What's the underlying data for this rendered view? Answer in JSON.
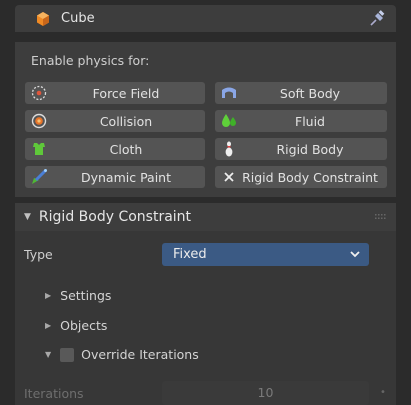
{
  "header": {
    "title": "Cube"
  },
  "physics": {
    "label": "Enable physics for:",
    "buttons": [
      {
        "label": "Force Field",
        "icon": "force-field-icon"
      },
      {
        "label": "Soft Body",
        "icon": "soft-body-icon"
      },
      {
        "label": "Collision",
        "icon": "collision-icon"
      },
      {
        "label": "Fluid",
        "icon": "fluid-icon"
      },
      {
        "label": "Cloth",
        "icon": "cloth-icon"
      },
      {
        "label": "Rigid Body",
        "icon": "rigid-body-icon"
      },
      {
        "label": "Dynamic Paint",
        "icon": "dynamic-paint-icon"
      },
      {
        "label": "Rigid Body Constraint",
        "icon": "close-icon"
      }
    ]
  },
  "section": {
    "title": "Rigid Body Constraint",
    "type_label": "Type",
    "type_value": "Fixed",
    "subpanels": [
      "Settings",
      "Objects"
    ],
    "override_label": "Override Iterations",
    "iterations_label": "Iterations",
    "iterations_value": "10"
  },
  "colors": {
    "accent": "#3b5a84",
    "panel": "#3d3d3d",
    "button": "#545454"
  }
}
